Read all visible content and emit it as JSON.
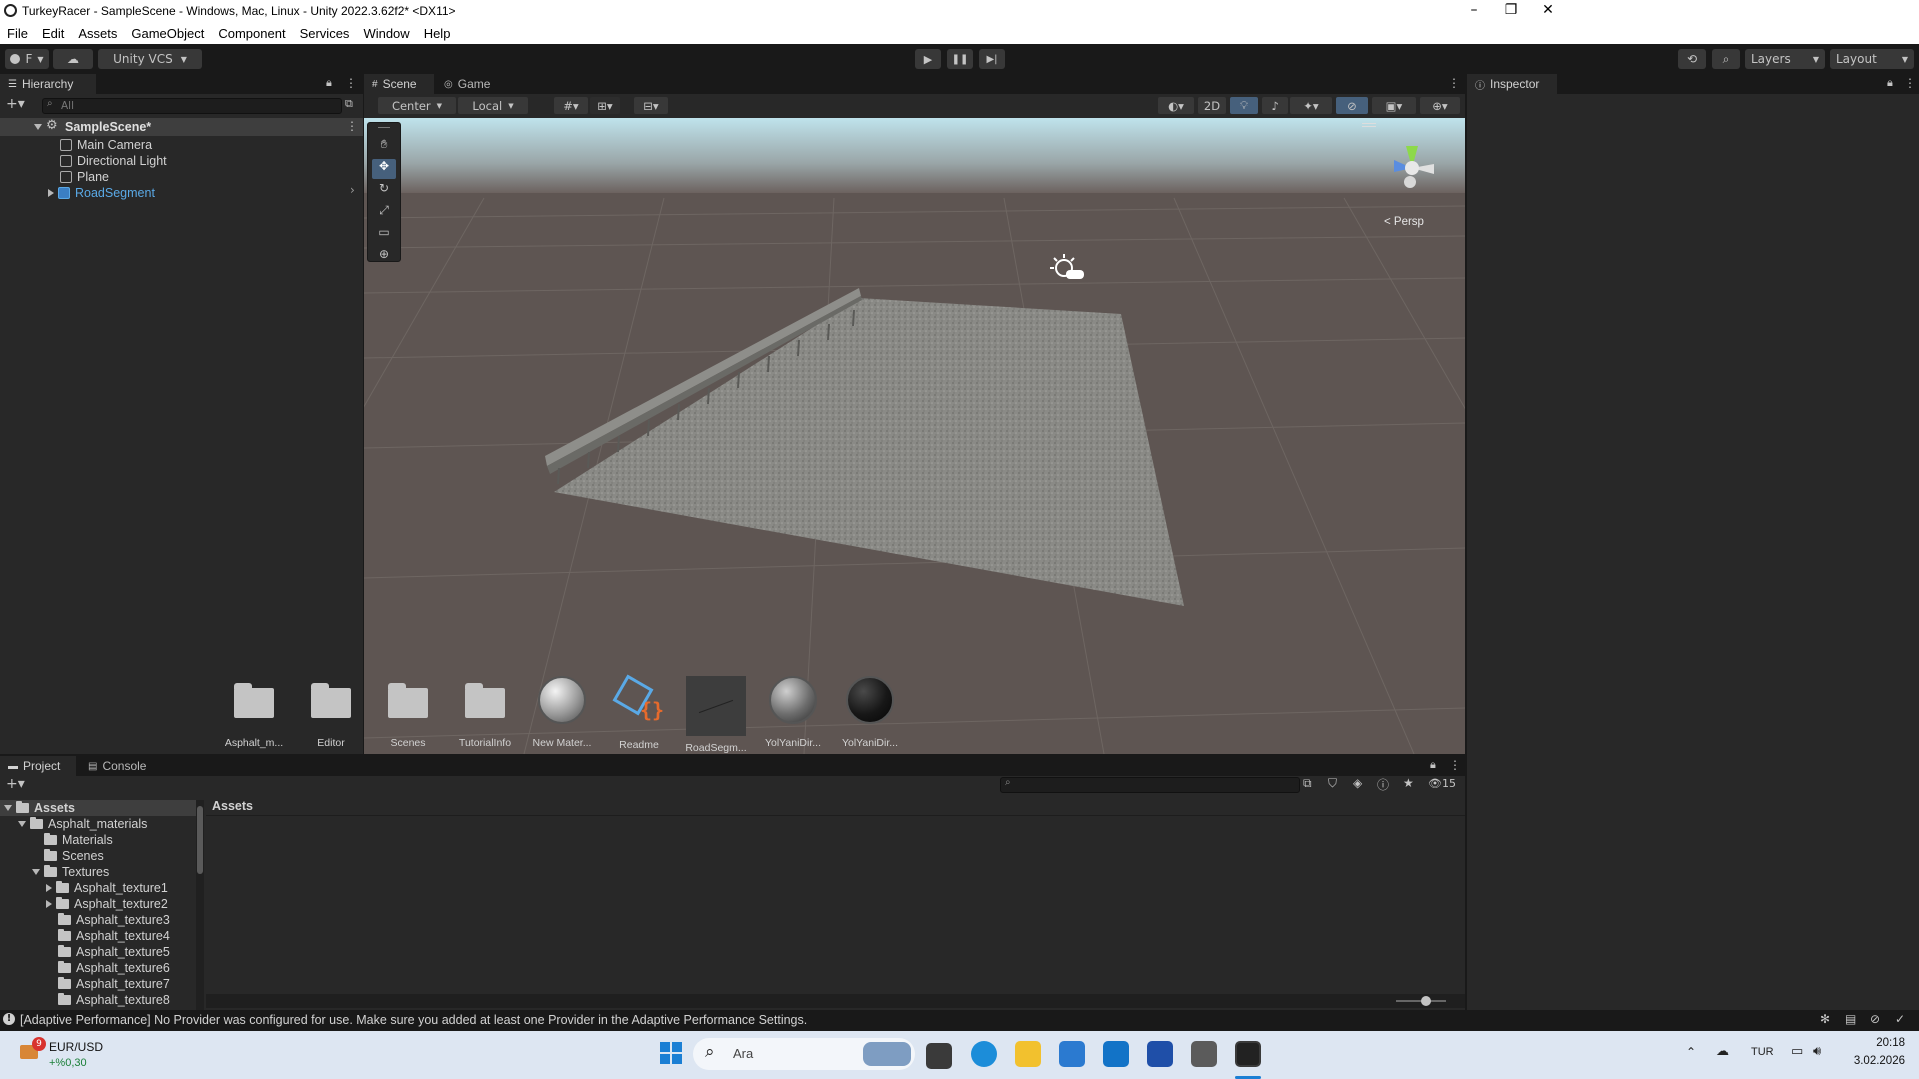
{
  "window": {
    "title": "TurkeyRacer - SampleScene - Windows, Mac, Linux - Unity 2022.3.62f2* <DX11>",
    "min": "–",
    "max": "❐",
    "close": "✕"
  },
  "menu": [
    "File",
    "Edit",
    "Assets",
    "GameObject",
    "Component",
    "Services",
    "Window",
    "Help"
  ],
  "toolbar": {
    "account": "F",
    "vcs": "Unity VCS",
    "layers": "Layers",
    "layout": "Layout"
  },
  "hierarchy": {
    "tab": "Hierarchy",
    "search_placeholder": "All",
    "scene": "SampleScene*",
    "items": [
      "Main Camera",
      "Directional Light",
      "Plane",
      "RoadSegment"
    ]
  },
  "scene": {
    "tab_scene": "Scene",
    "tab_game": "Game",
    "pivot": "Center",
    "space": "Local",
    "mode_2d": "2D",
    "persp": "< Persp"
  },
  "inspector": {
    "tab": "Inspector"
  },
  "project": {
    "tab_project": "Project",
    "tab_console": "Console",
    "breadcrumb": "Assets",
    "hidden_count": "15",
    "tree": [
      {
        "label": "Assets",
        "indent": 0,
        "arrow": "down",
        "bold": true
      },
      {
        "label": "Asphalt_materials",
        "indent": 1,
        "arrow": "down"
      },
      {
        "label": "Materials",
        "indent": 2,
        "arrow": ""
      },
      {
        "label": "Scenes",
        "indent": 2,
        "arrow": ""
      },
      {
        "label": "Textures",
        "indent": 2,
        "arrow": "down"
      },
      {
        "label": "Asphalt_texture1",
        "indent": 3,
        "arrow": "right"
      },
      {
        "label": "Asphalt_texture2",
        "indent": 3,
        "arrow": "right"
      },
      {
        "label": "Asphalt_texture3",
        "indent": 3,
        "arrow": ""
      },
      {
        "label": "Asphalt_texture4",
        "indent": 3,
        "arrow": ""
      },
      {
        "label": "Asphalt_texture5",
        "indent": 3,
        "arrow": ""
      },
      {
        "label": "Asphalt_texture6",
        "indent": 3,
        "arrow": ""
      },
      {
        "label": "Asphalt_texture7",
        "indent": 3,
        "arrow": ""
      },
      {
        "label": "Asphalt_texture8",
        "indent": 3,
        "arrow": ""
      }
    ],
    "assets": [
      {
        "label": "Asphalt_m...",
        "kind": "folder"
      },
      {
        "label": "Editor",
        "kind": "folder"
      },
      {
        "label": "Scenes",
        "kind": "folder"
      },
      {
        "label": "TutorialInfo",
        "kind": "folder"
      },
      {
        "label": "New Mater...",
        "kind": "material-light"
      },
      {
        "label": "Readme",
        "kind": "script"
      },
      {
        "label": "RoadSegm...",
        "kind": "prefab"
      },
      {
        "label": "YolYaniDir...",
        "kind": "material-grey"
      },
      {
        "label": "YolYaniDir...",
        "kind": "material-dark"
      }
    ]
  },
  "status": {
    "message": "[Adaptive Performance] No Provider was configured for use. Make sure you added at least one Provider in the Adaptive Performance Settings."
  },
  "taskbar": {
    "ticker": "EUR/USD",
    "ticker_change": "+%0,30",
    "badge": "9",
    "search": "Ara",
    "lang": "TUR",
    "time": "20:18",
    "date": "3.02.2026"
  },
  "colors": {
    "accent": "#3a79bb",
    "panel": "#282828",
    "chrome": "#191919",
    "sky_top": "#bfe0ea",
    "ground": "#5e5552"
  }
}
